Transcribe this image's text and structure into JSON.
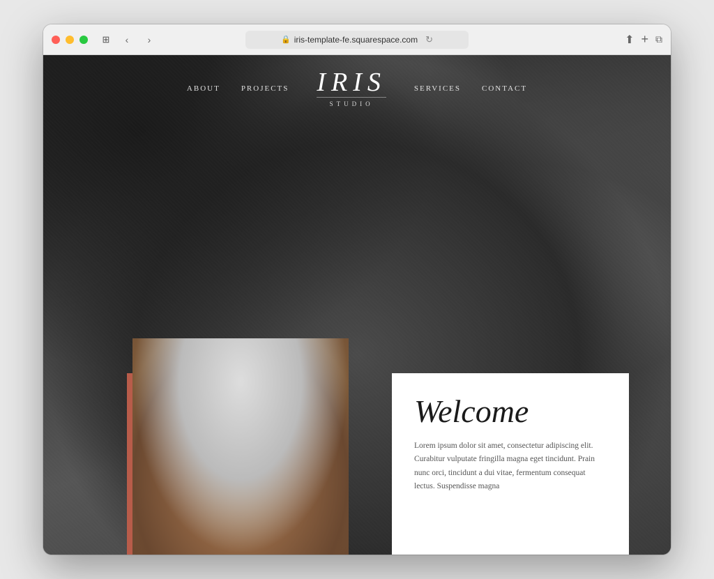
{
  "browser": {
    "url": "iris-template-fe.squarespace.com",
    "lock_icon": "🔒",
    "reload_icon": "↻",
    "back_icon": "‹",
    "forward_icon": "›",
    "share_icon": "⬆",
    "new_tab_icon": "+",
    "tabs_icon": "⧉",
    "view_icon": "⊞"
  },
  "nav": {
    "links_left": [
      {
        "label": "ABOUT"
      },
      {
        "label": "PROJECTS"
      }
    ],
    "links_right": [
      {
        "label": "SERVICES"
      },
      {
        "label": "CONTACT"
      }
    ]
  },
  "logo": {
    "title": "IRIS",
    "subtitle": "STUDIO"
  },
  "welcome": {
    "title": "Welcome",
    "body": "Lorem ipsum dolor sit amet, consectetur adipiscing elit. Curabitur vulputate fringilla magna eget tincidunt. Prain nunc orci, tincidunt a dui vitae, fermentum consequat lectus. Suspendisse magna"
  }
}
